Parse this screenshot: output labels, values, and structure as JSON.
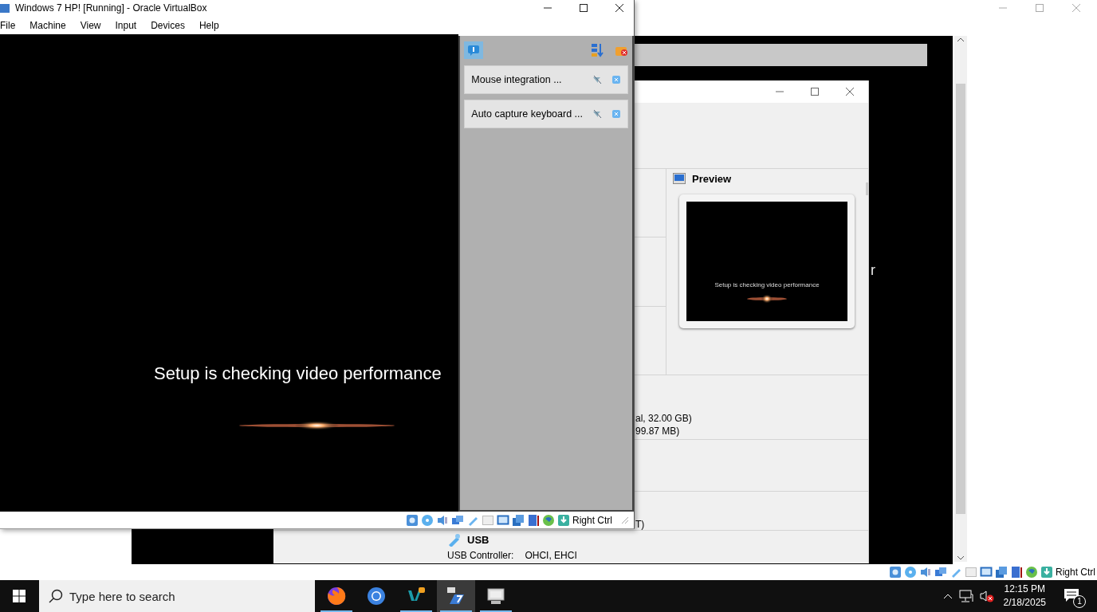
{
  "background_window": {
    "screen_text": "r",
    "status_bar": {
      "host_key": "Right Ctrl"
    }
  },
  "manager_window": {
    "preview": {
      "title": "Preview",
      "screen_text": "Setup is checking video performance"
    },
    "storage_lines": [
      "al, 32.00 GB)",
      "99.87 MB)"
    ],
    "audio_line": "T)",
    "usb": {
      "title": "USB",
      "label": "USB Controller:",
      "value": "OHCI, EHCI"
    }
  },
  "vm_window": {
    "title": "Windows 7 HP! [Running] - Oracle VirtualBox",
    "menu": [
      "File",
      "Machine",
      "View",
      "Input",
      "Devices",
      "Help"
    ],
    "screen_text": "Setup is checking video performance",
    "notifications": [
      "Mouse integration ...",
      "Auto capture keyboard ..."
    ],
    "status_bar": {
      "host_key": "Right Ctrl"
    }
  },
  "taskbar": {
    "search": {
      "placeholder": "Type here to search"
    },
    "apps": [
      {
        "kind": "firefox",
        "running": true,
        "selected": false
      },
      {
        "kind": "chrome",
        "running": false,
        "selected": false
      },
      {
        "kind": "virtualbox",
        "running": true,
        "selected": false
      },
      {
        "kind": "vm",
        "running": true,
        "selected": true
      },
      {
        "kind": "monitor",
        "running": true,
        "selected": false
      }
    ],
    "time": "12:15 PM",
    "date": "2/18/2025",
    "notification_count": "1"
  }
}
